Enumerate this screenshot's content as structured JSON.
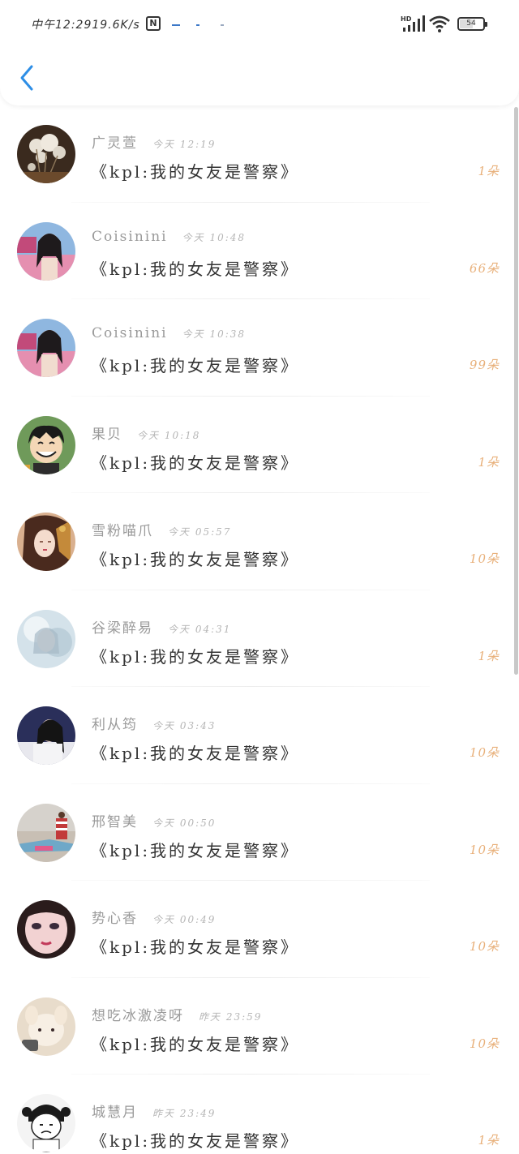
{
  "status_bar": {
    "time": "中午12:29",
    "speed": "19.6K/s",
    "nfc_label": "N",
    "network": "HD",
    "battery_level": "54"
  },
  "nav": {
    "back_icon": "chevron-left-icon"
  },
  "accent_colors": {
    "back": "#2d8ee6",
    "count": "#e8b07a",
    "name": "#9a9a9a",
    "text": "#333333"
  },
  "items": [
    {
      "name": "广灵萱",
      "time": "今天 12:19",
      "gift": "《kpl:我的女友是警察》",
      "count": "1朵"
    },
    {
      "name": "Coisinini",
      "time": "今天 10:48",
      "gift": "《kpl:我的女友是警察》",
      "count": "66朵"
    },
    {
      "name": "Coisinini",
      "time": "今天 10:38",
      "gift": "《kpl:我的女友是警察》",
      "count": "99朵"
    },
    {
      "name": "果贝",
      "time": "今天 10:18",
      "gift": "《kpl:我的女友是警察》",
      "count": "1朵"
    },
    {
      "name": "雪粉喵爪",
      "time": "今天 05:57",
      "gift": "《kpl:我的女友是警察》",
      "count": "10朵"
    },
    {
      "name": "谷梁醉易",
      "time": "今天 04:31",
      "gift": "《kpl:我的女友是警察》",
      "count": "1朵"
    },
    {
      "name": "利从筠",
      "time": "今天 03:43",
      "gift": "《kpl:我的女友是警察》",
      "count": "10朵"
    },
    {
      "name": "邢智美",
      "time": "今天 00:50",
      "gift": "《kpl:我的女友是警察》",
      "count": "10朵"
    },
    {
      "name": "势心香",
      "time": "今天 00:49",
      "gift": "《kpl:我的女友是警察》",
      "count": "10朵"
    },
    {
      "name": "想吃冰激凌呀",
      "time": "昨天 23:59",
      "gift": "《kpl:我的女友是警察》",
      "count": "10朵"
    },
    {
      "name": "城慧月",
      "time": "昨天 23:49",
      "gift": "《kpl:我的女友是警察》",
      "count": "1朵"
    }
  ]
}
